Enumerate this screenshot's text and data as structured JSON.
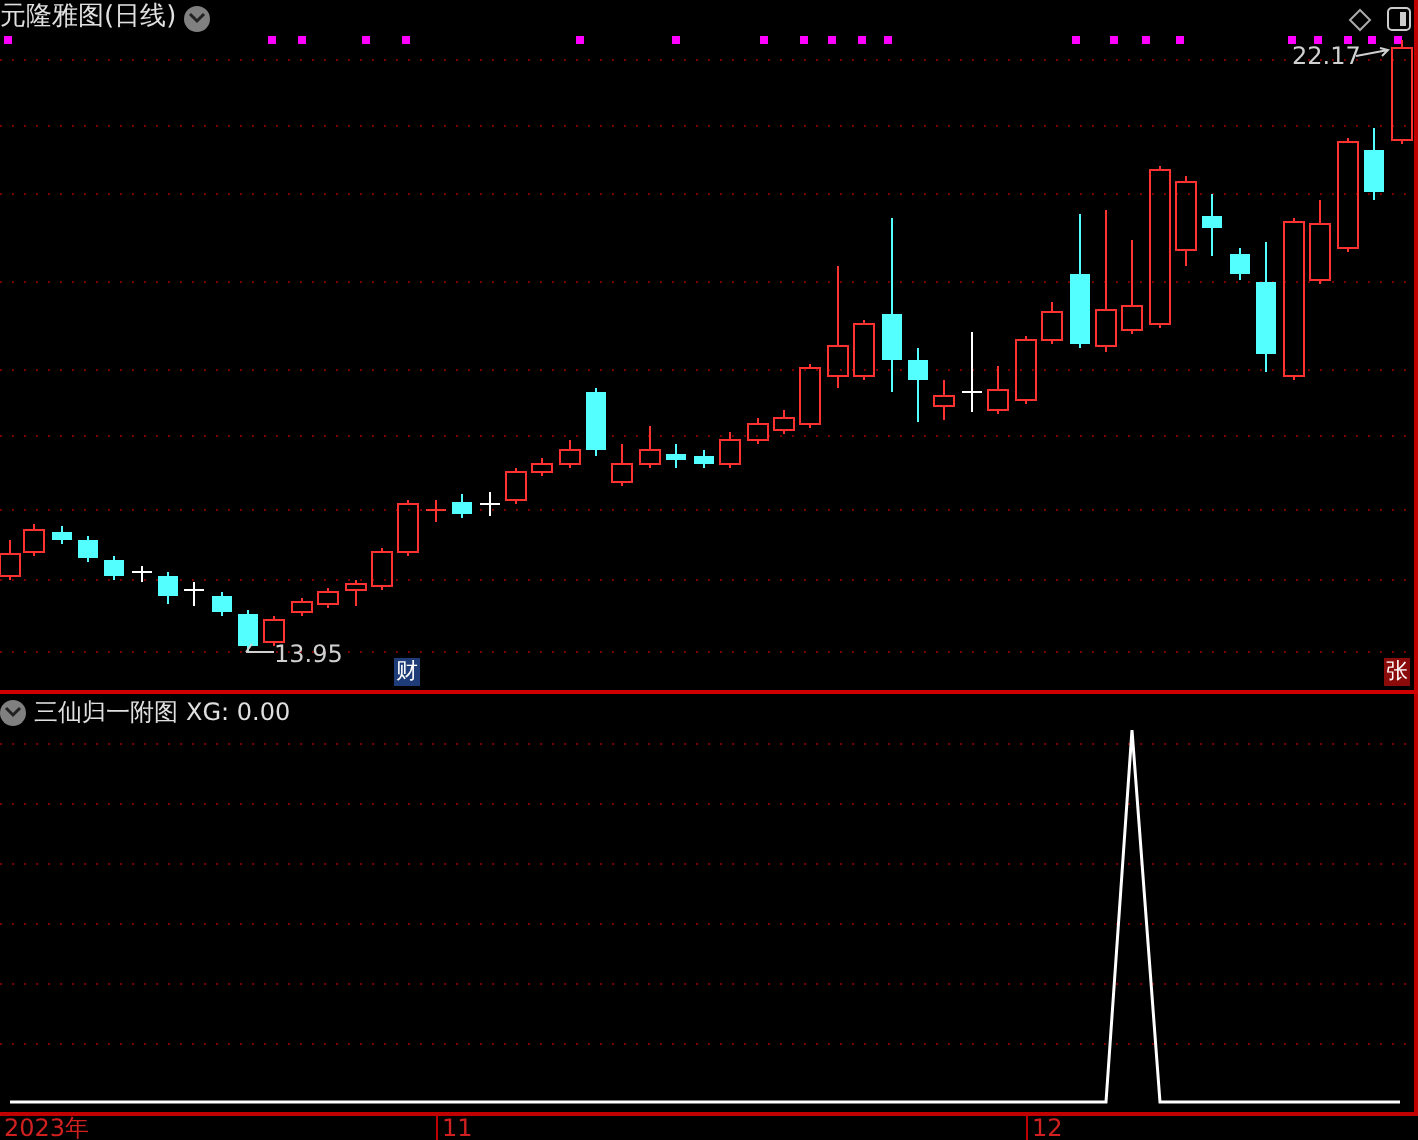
{
  "main_chart": {
    "title": "元隆雅图(日线)",
    "high_label": "22.17",
    "low_label": "13.95",
    "markers": [
      {
        "text": "财",
        "color": "#1d3c78"
      },
      {
        "text": "张",
        "color": "#8b0a0a"
      }
    ]
  },
  "indicator_panel": {
    "title": "三仙归一附图",
    "reading": "XG: 0.00"
  },
  "time_axis": {
    "labels": [
      "2023年",
      "11",
      "12"
    ]
  }
}
